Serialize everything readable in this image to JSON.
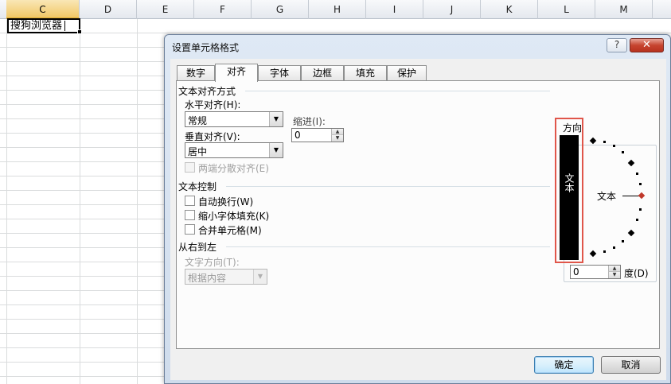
{
  "sheet": {
    "columns": [
      "C",
      "D",
      "E",
      "F",
      "G",
      "H",
      "I",
      "J",
      "K",
      "L",
      "M"
    ],
    "active_cell_value": "搜狗浏览器"
  },
  "dialog": {
    "title": "设置单元格格式",
    "help_label": "?",
    "close_label": "✕",
    "tabs": [
      "数字",
      "对齐",
      "字体",
      "边框",
      "填充",
      "保护"
    ],
    "active_tab": "对齐",
    "text_alignment": {
      "group": "文本对齐方式",
      "horizontal_label": "水平对齐(H):",
      "horizontal_value": "常规",
      "indent_label": "缩进(I):",
      "indent_value": "0",
      "vertical_label": "垂直对齐(V):",
      "vertical_value": "居中",
      "distributed_label": "两端分散对齐(E)"
    },
    "text_control": {
      "group": "文本控制",
      "wrap_label": "自动换行(W)",
      "shrink_label": "缩小字体填充(K)",
      "merge_label": "合并单元格(M)"
    },
    "rtl": {
      "group": "从右到左",
      "direction_label": "文字方向(T):",
      "direction_value": "根据内容"
    },
    "orientation": {
      "title": "方向",
      "vertical_text": "文本",
      "dial_text": "文本",
      "degree_value": "0",
      "degree_label": "度(D)"
    },
    "ok_label": "确定",
    "cancel_label": "取消",
    "accent_color": "#e0564a"
  }
}
